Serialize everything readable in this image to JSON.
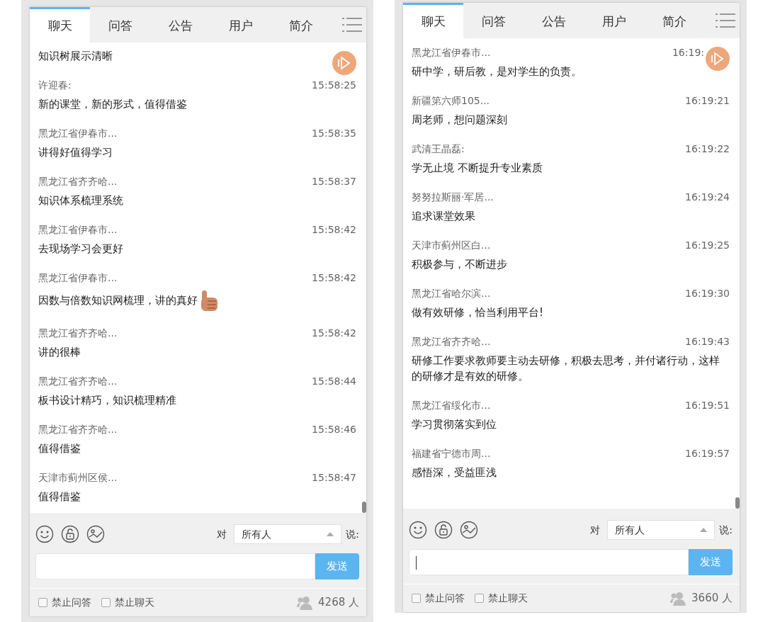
{
  "panels": [
    {
      "tabs": [
        {
          "label": "聊天",
          "selected": true
        },
        {
          "label": "问答",
          "selected": false
        },
        {
          "label": "公告",
          "selected": false
        },
        {
          "label": "用户",
          "selected": false
        },
        {
          "label": "简介",
          "selected": false
        }
      ],
      "messages": [
        {
          "text": "知识树展示清晰"
        },
        {
          "name": "许迎春:",
          "time": "15:58:25",
          "text": "新的课堂，新的形式，值得借鉴"
        },
        {
          "name": "黑龙江省伊春市...",
          "time": "15:58:35",
          "text": "讲得好值得学习"
        },
        {
          "name": "黑龙江省齐齐哈...",
          "time": "15:58:37",
          "text": "知识体系梳理系统"
        },
        {
          "name": "黑龙江省伊春市...",
          "time": "15:58:42",
          "text": "去现场学习会更好"
        },
        {
          "name": "黑龙江省伊春市...",
          "time": "15:58:42",
          "text": "因数与倍数知识网梳理，讲的真好",
          "thumbs_up": true
        },
        {
          "name": "黑龙江省齐齐哈...",
          "time": "15:58:42",
          "text": "讲的很棒"
        },
        {
          "name": "黑龙江省齐齐哈...",
          "time": "15:58:44",
          "text": "板书设计精巧，知识梳理精准"
        },
        {
          "name": "黑龙江省齐齐哈...",
          "time": "15:58:46",
          "text": "值得借鉴"
        },
        {
          "name": "天津市蓟州区侯...",
          "time": "15:58:47",
          "text": "值得借鉴"
        }
      ],
      "to_label": "对",
      "recipient": "所有人",
      "say_label": "说:",
      "input_focused": false,
      "send": "发送",
      "checkboxes": [
        {
          "label": "禁止问答",
          "checked": false
        },
        {
          "label": "禁止聊天",
          "checked": false
        }
      ],
      "online": "4268 人"
    },
    {
      "tabs": [
        {
          "label": "聊天",
          "selected": true
        },
        {
          "label": "问答",
          "selected": false
        },
        {
          "label": "公告",
          "selected": false
        },
        {
          "label": "用户",
          "selected": false
        },
        {
          "label": "简介",
          "selected": false
        }
      ],
      "messages": [
        {
          "name": "黑龙江省伊春市...",
          "time": "16:19:",
          "text": "研中学，研后教，是对学生的负责。"
        },
        {
          "name": "新疆第六师105...",
          "time": "16:19:21",
          "text": "周老师，想问题深刻"
        },
        {
          "name": "武清王晶磊:",
          "time": "16:19:22",
          "text": "学无止境 不断提升专业素质"
        },
        {
          "name": "努努拉斯丽·军居...",
          "time": "16:19:24",
          "text": "追求课堂效果"
        },
        {
          "name": "天津市蓟州区白...",
          "time": "16:19:25",
          "text": "积极参与，不断进步"
        },
        {
          "name": "黑龙江省哈尔滨...",
          "time": "16:19:30",
          "text": "做有效研修，恰当利用平台!"
        },
        {
          "name": "黑龙江省齐齐哈...",
          "time": "16:19:43",
          "text": "研修工作要求教师要主动去研修，积极去思考，并付诸行动，这样的研修才是有效的研修。"
        },
        {
          "name": "黑龙江省绥化市...",
          "time": "16:19:51",
          "text": "学习贯彻落实到位"
        },
        {
          "name": "福建省宁德市周...",
          "time": "16:19:57",
          "text": "感悟深，受益匪浅"
        }
      ],
      "to_label": "对",
      "recipient": "所有人",
      "say_label": "说:",
      "input_focused": true,
      "send": "发送",
      "checkboxes": [
        {
          "label": "禁止问答",
          "checked": false
        },
        {
          "label": "禁止聊天",
          "checked": false
        }
      ],
      "online": "3660 人"
    }
  ]
}
